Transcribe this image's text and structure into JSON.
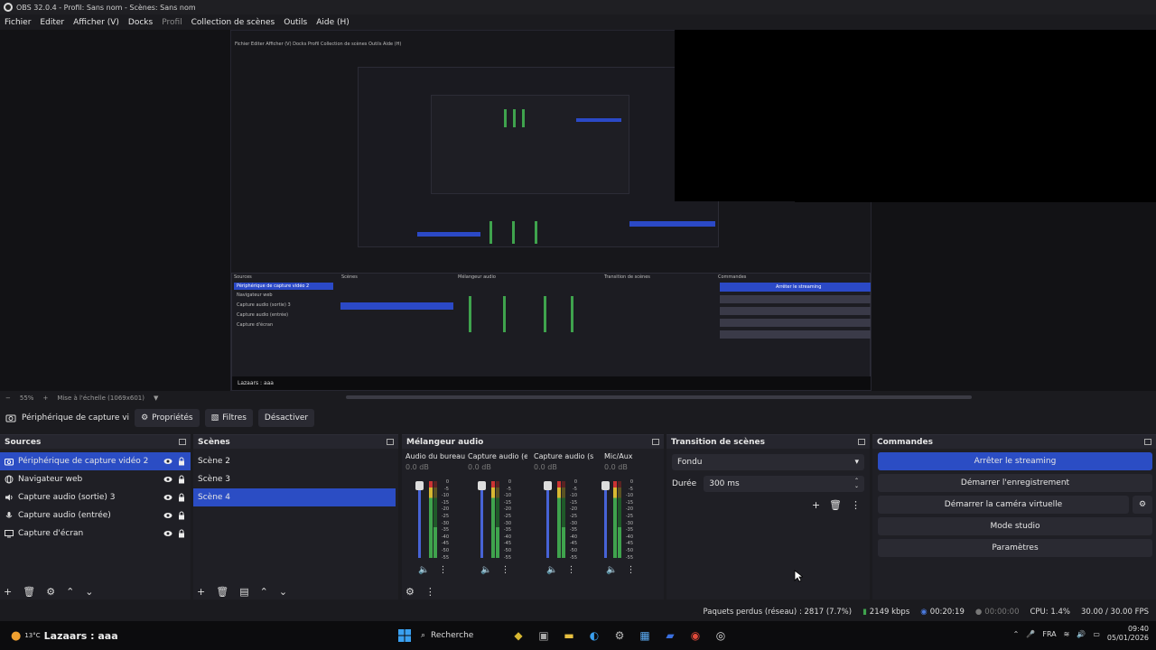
{
  "window": {
    "title": "OBS 32.0.4 - Profil: Sans nom - Scènes: Sans nom"
  },
  "menu": [
    "Fichier",
    "Editer",
    "Afficher (V)",
    "Docks",
    "Profil",
    "Collection de scènes",
    "Outils",
    "Aide (H)"
  ],
  "preview_status": {
    "zoom": "55%",
    "scale_label": "Mise à l'échelle (1069x601)"
  },
  "source_toolbar": {
    "source_name": "Périphérique de capture vi",
    "properties": "Propriétés",
    "filters": "Filtres",
    "deactivate": "Désactiver"
  },
  "sources": {
    "title": "Sources",
    "items": [
      "Périphérique de capture vidéo 2",
      "Navigateur web",
      "Capture audio (sortie) 3",
      "Capture audio (entrée)",
      "Capture d'écran"
    ],
    "selected_index": 0
  },
  "scenes": {
    "title": "Scènes",
    "items": [
      "Scène 2",
      "Scène 3",
      "Scène 4"
    ],
    "selected_index": 2
  },
  "mixer": {
    "title": "Mélangeur audio",
    "channels": [
      {
        "name": "Audio du bureau",
        "db": "0.0 dB"
      },
      {
        "name": "Capture audio (ent",
        "db": "0.0 dB"
      },
      {
        "name": "Capture audio (son",
        "db": "0.0 dB"
      },
      {
        "name": "Mic/Aux",
        "db": "0.0 dB"
      }
    ],
    "scale": [
      "0",
      "-5",
      "-10",
      "-15",
      "-20",
      "-25",
      "-30",
      "-35",
      "-40",
      "-45",
      "-50",
      "-55",
      "-60"
    ]
  },
  "transitions": {
    "title": "Transition de scènes",
    "selected": "Fondu",
    "duration_label": "Durée",
    "duration_value": "300 ms"
  },
  "commands": {
    "title": "Commandes",
    "stop_streaming": "Arrêter le streaming",
    "start_recording": "Démarrer l'enregistrement",
    "start_virtual_cam": "Démarrer la caméra virtuelle",
    "studio_mode": "Mode studio",
    "settings": "Paramètres"
  },
  "status": {
    "dropped": "Paquets perdus (réseau) : 2817 (7.7%)",
    "bitrate": "2149 kbps",
    "stream_time": "00:20:19",
    "rec_time": "00:00:00",
    "cpu": "CPU: 1.4%",
    "fps": "30.00 / 30.00 FPS"
  },
  "taskbar": {
    "temp": "13°C",
    "user": "Lazaars : aaa",
    "search": "Recherche",
    "lang": "FRA",
    "time": "09:40",
    "date": "05/01/2026"
  },
  "colors": {
    "accent": "#2b4dc4",
    "meter_green": "#3fa34d",
    "meter_yellow": "#d8b832",
    "meter_red": "#cc3333"
  }
}
